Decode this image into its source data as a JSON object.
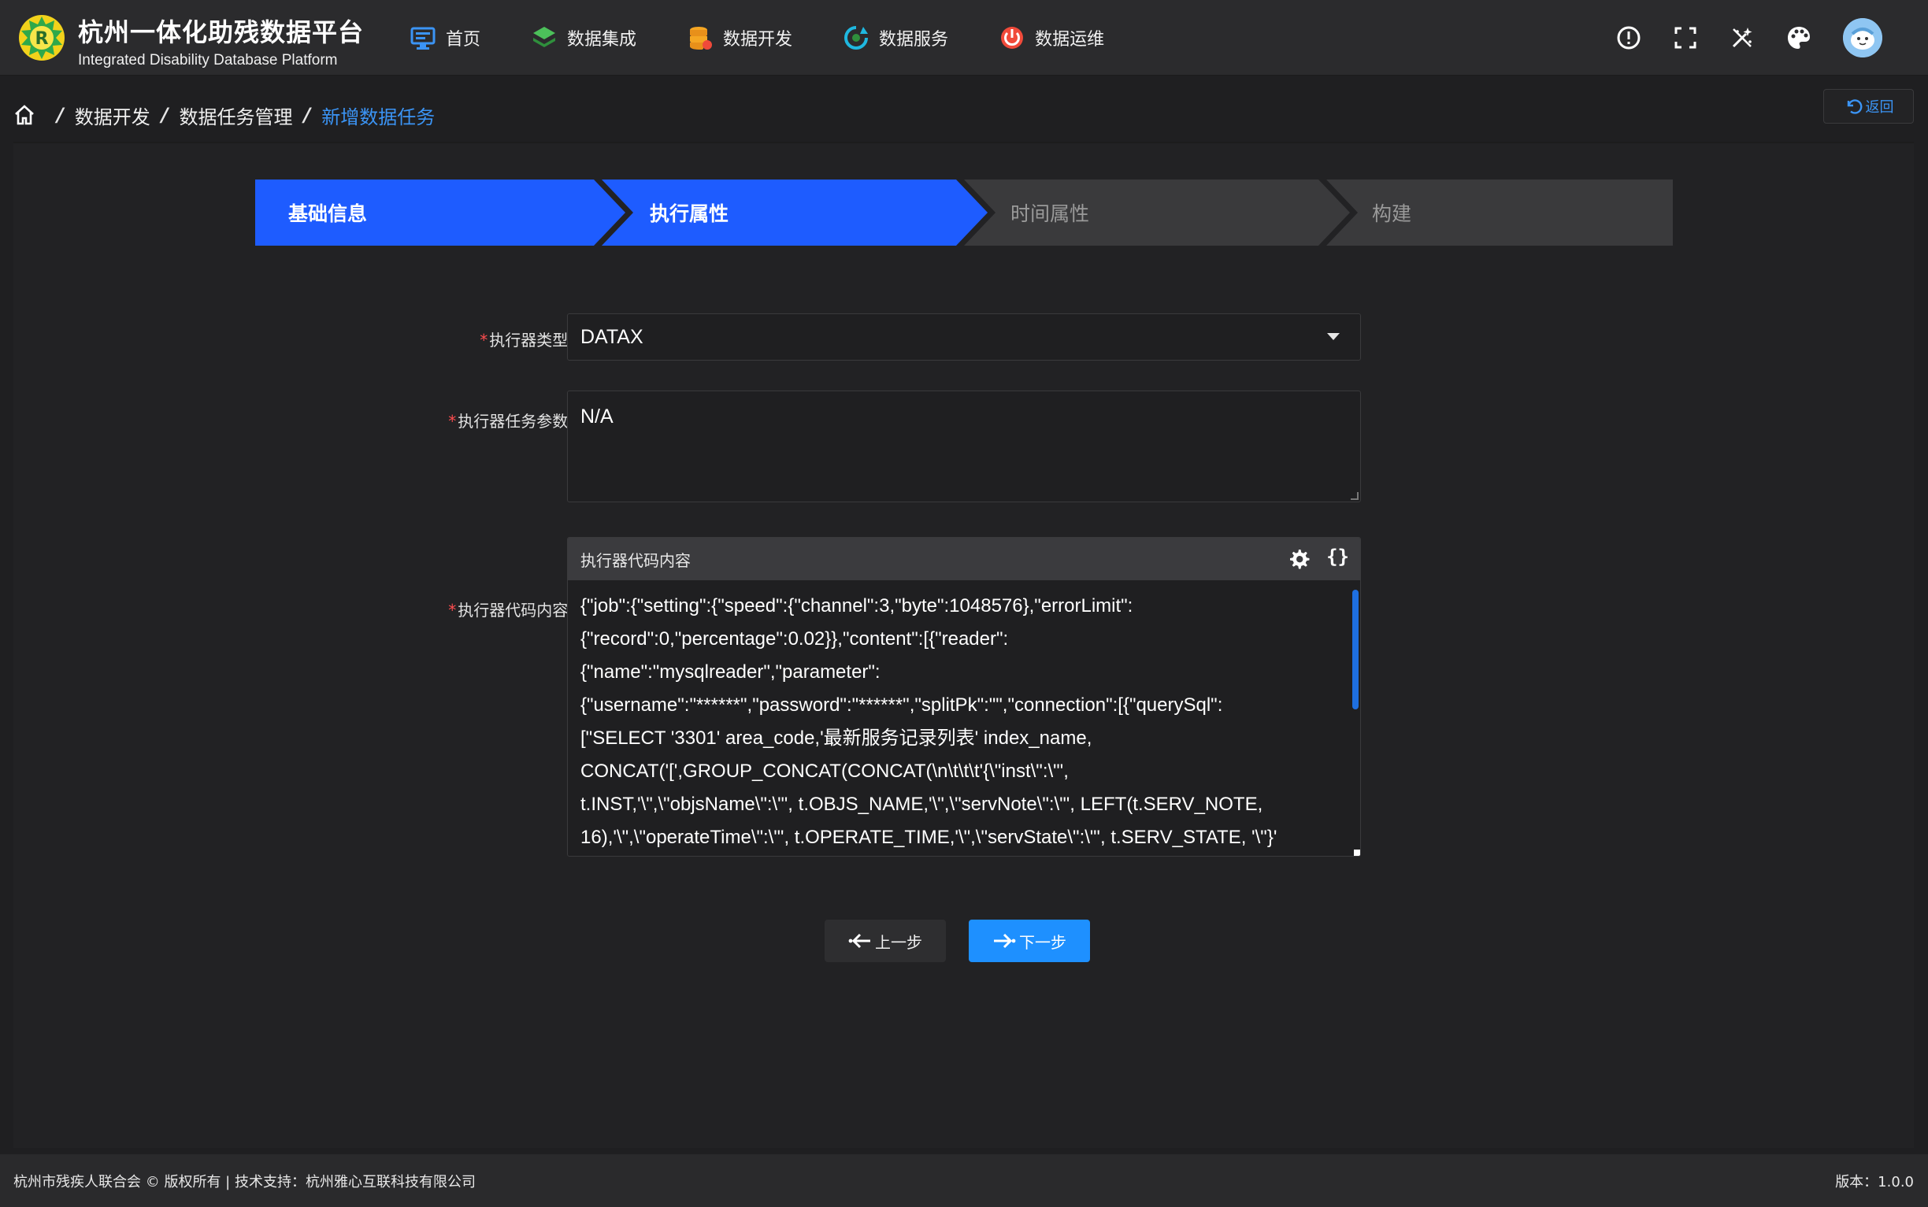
{
  "app": {
    "title_cn": "杭州一体化助残数据平台",
    "title_en": "Integrated Disability Database Platform"
  },
  "nav": [
    {
      "label": "首页",
      "icon": "monitor-icon",
      "color": "#3b94f5"
    },
    {
      "label": "数据集成",
      "icon": "layers-icon",
      "color": "#4cc05a"
    },
    {
      "label": "数据开发",
      "icon": "database-icon",
      "color": "#f5a623"
    },
    {
      "label": "数据服务",
      "icon": "refresh-service-icon",
      "color": "#1fb8e0"
    },
    {
      "label": "数据运维",
      "icon": "power-icon",
      "color": "#f04a3a"
    }
  ],
  "tools": [
    "alert-icon",
    "fullscreen-icon",
    "magic-wand-off-icon",
    "palette-icon",
    "user-avatar"
  ],
  "breadcrumb": {
    "items": [
      "数据开发",
      "数据任务管理"
    ],
    "current": "新增数据任务"
  },
  "back_label": "返回",
  "steps": [
    {
      "label": "基础信息",
      "state": "done"
    },
    {
      "label": "执行属性",
      "state": "active"
    },
    {
      "label": "时间属性",
      "state": "pending"
    },
    {
      "label": "构建",
      "state": "pending"
    }
  ],
  "form": {
    "executor_type": {
      "label": "执行器类型:",
      "value": "DATAX"
    },
    "executor_params": {
      "label": "执行器任务参数:",
      "value": "N/A"
    },
    "executor_code": {
      "label": "执行器代码内容:",
      "header": "执行器代码内容",
      "lines": [
        "{\"job\":{\"setting\":{\"speed\":{\"channel\":3,\"byte\":1048576},\"errorLimit\":",
        "{\"record\":0,\"percentage\":0.02}},\"content\":[{\"reader\":",
        "{\"name\":\"mysqlreader\",\"parameter\":",
        "{\"username\":\"******\",\"password\":\"******\",\"splitPk\":\"\",\"connection\":[{\"querySql\":",
        "[\"SELECT '3301' area_code,'最新服务记录列表' index_name,",
        "CONCAT('[',GROUP_CONCAT(CONCAT(\\n\\t\\t\\t'{\\\"inst\\\":\\\"',",
        "t.INST,'\\\",\\\"objsName\\\":\\\"', t.OBJS_NAME,'\\\",\\\"servNote\\\":\\\"', LEFT(t.SERV_NOTE,",
        "16),'\\\",\\\"operateTime\\\":\\\"', t.OPERATE_TIME,'\\\",\\\"servState\\\":\\\"', t.SERV_STATE, '\\\"}'"
      ]
    }
  },
  "buttons": {
    "prev": "上一步",
    "next": "下一步"
  },
  "footer": {
    "copyright": "杭州市残疾人联合会 © 版权所有 | 技术支持：杭州雅心互联科技有限公司",
    "version": "版本：1.0.0"
  },
  "colors": {
    "accent": "#1e5cff",
    "link": "#3b94f5",
    "primary_button": "#1e90ff",
    "step_pending": "#3a3a3c"
  }
}
